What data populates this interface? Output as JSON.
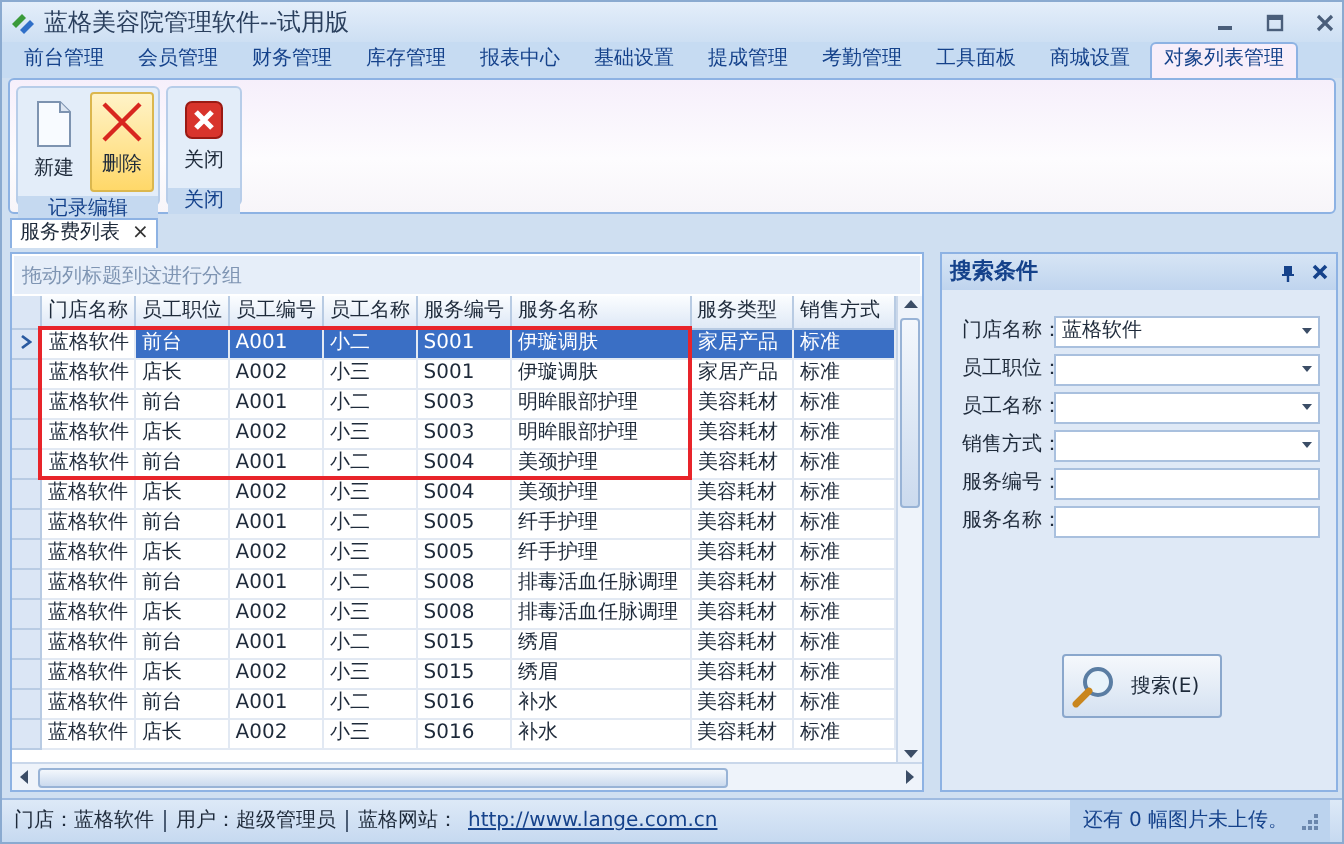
{
  "window": {
    "title": "蓝格美容院管理软件--试用版"
  },
  "ribbon_tabs": [
    {
      "label": "前台管理",
      "selected": false
    },
    {
      "label": "会员管理",
      "selected": false
    },
    {
      "label": "财务管理",
      "selected": false
    },
    {
      "label": "库存管理",
      "selected": false
    },
    {
      "label": "报表中心",
      "selected": false
    },
    {
      "label": "基础设置",
      "selected": false
    },
    {
      "label": "提成管理",
      "selected": false
    },
    {
      "label": "考勤管理",
      "selected": false
    },
    {
      "label": "工具面板",
      "selected": false
    },
    {
      "label": "商城设置",
      "selected": false
    },
    {
      "label": "对象列表管理",
      "selected": true
    }
  ],
  "ribbon_groups": [
    {
      "label": "记录编辑",
      "buttons": [
        {
          "label": "新建",
          "kind": "new",
          "highlighted": false
        },
        {
          "label": "删除",
          "kind": "delete",
          "highlighted": true
        }
      ]
    },
    {
      "label": "关闭",
      "buttons": [
        {
          "label": "关闭",
          "kind": "close",
          "highlighted": false
        }
      ]
    }
  ],
  "document_tabs": [
    {
      "label": "服务费列表",
      "selected": true,
      "close": "×"
    }
  ],
  "grid": {
    "group_hint": "拖动列标题到这进行分组",
    "columns": [
      {
        "label": "门店名称",
        "framed": true
      },
      {
        "label": "员工职位",
        "framed": true
      },
      {
        "label": "员工编号",
        "framed": true
      },
      {
        "label": "员工名称",
        "framed": true
      },
      {
        "label": "服务编号",
        "framed": true
      },
      {
        "label": "服务名称",
        "framed": true
      },
      {
        "label": "服务类型",
        "framed": false
      },
      {
        "label": "销售方式",
        "framed": false
      }
    ],
    "rows": [
      {
        "cells": [
          "蓝格软件",
          "前台",
          "A001",
          "小二",
          "S001",
          "伊璇调肤",
          "家居产品",
          "标准"
        ],
        "selected": true,
        "framed": true
      },
      {
        "cells": [
          "蓝格软件",
          "店长",
          "A002",
          "小三",
          "S001",
          "伊璇调肤",
          "家居产品",
          "标准"
        ],
        "selected": false,
        "framed": true
      },
      {
        "cells": [
          "蓝格软件",
          "前台",
          "A001",
          "小二",
          "S003",
          "明眸眼部护理",
          "美容耗材",
          "标准"
        ],
        "selected": false,
        "framed": true
      },
      {
        "cells": [
          "蓝格软件",
          "店长",
          "A002",
          "小三",
          "S003",
          "明眸眼部护理",
          "美容耗材",
          "标准"
        ],
        "selected": false,
        "framed": true
      },
      {
        "cells": [
          "蓝格软件",
          "前台",
          "A001",
          "小二",
          "S004",
          "美颈护理",
          "美容耗材",
          "标准"
        ],
        "selected": false,
        "framed": true
      },
      {
        "cells": [
          "蓝格软件",
          "店长",
          "A002",
          "小三",
          "S004",
          "美颈护理",
          "美容耗材",
          "标准"
        ],
        "selected": false,
        "framed": false
      },
      {
        "cells": [
          "蓝格软件",
          "前台",
          "A001",
          "小二",
          "S005",
          "纤手护理",
          "美容耗材",
          "标准"
        ],
        "selected": false,
        "framed": false
      },
      {
        "cells": [
          "蓝格软件",
          "店长",
          "A002",
          "小三",
          "S005",
          "纤手护理",
          "美容耗材",
          "标准"
        ],
        "selected": false,
        "framed": false
      },
      {
        "cells": [
          "蓝格软件",
          "前台",
          "A001",
          "小二",
          "S008",
          "排毒活血任脉调理",
          "美容耗材",
          "标准"
        ],
        "selected": false,
        "framed": false
      },
      {
        "cells": [
          "蓝格软件",
          "店长",
          "A002",
          "小三",
          "S008",
          "排毒活血任脉调理",
          "美容耗材",
          "标准"
        ],
        "selected": false,
        "framed": false
      },
      {
        "cells": [
          "蓝格软件",
          "前台",
          "A001",
          "小二",
          "S015",
          "绣眉",
          "美容耗材",
          "标准"
        ],
        "selected": false,
        "framed": false
      },
      {
        "cells": [
          "蓝格软件",
          "店长",
          "A002",
          "小三",
          "S015",
          "绣眉",
          "美容耗材",
          "标准"
        ],
        "selected": false,
        "framed": false
      },
      {
        "cells": [
          "蓝格软件",
          "前台",
          "A001",
          "小二",
          "S016",
          "补水",
          "美容耗材",
          "标准"
        ],
        "selected": false,
        "framed": false
      },
      {
        "cells": [
          "蓝格软件",
          "店长",
          "A002",
          "小三",
          "S016",
          "补水",
          "美容耗材",
          "标准"
        ],
        "selected": false,
        "framed": false
      }
    ]
  },
  "search_panel": {
    "title": "搜索条件",
    "fields": [
      {
        "label": "门店名称：",
        "kind": "select",
        "value": "蓝格软件"
      },
      {
        "label": "员工职位：",
        "kind": "select"
      },
      {
        "label": "员工名称：",
        "kind": "select"
      },
      {
        "label": "销售方式：",
        "kind": "select"
      },
      {
        "label": "服务编号：",
        "kind": "text"
      },
      {
        "label": "服务名称：",
        "kind": "text"
      }
    ],
    "button": "搜索(E)"
  },
  "status_bar": {
    "segments": [
      {
        "kind": "text",
        "text": "门店：蓝格软件"
      },
      {
        "kind": "separator"
      },
      {
        "kind": "text",
        "text": "用户：超级管理员"
      },
      {
        "kind": "separator"
      },
      {
        "kind": "text",
        "text": "蓝格网站："
      },
      {
        "kind": "link",
        "text": "http://www.lange.com.cn"
      }
    ],
    "upload_note": "还有 0 幅图片未上传。"
  }
}
